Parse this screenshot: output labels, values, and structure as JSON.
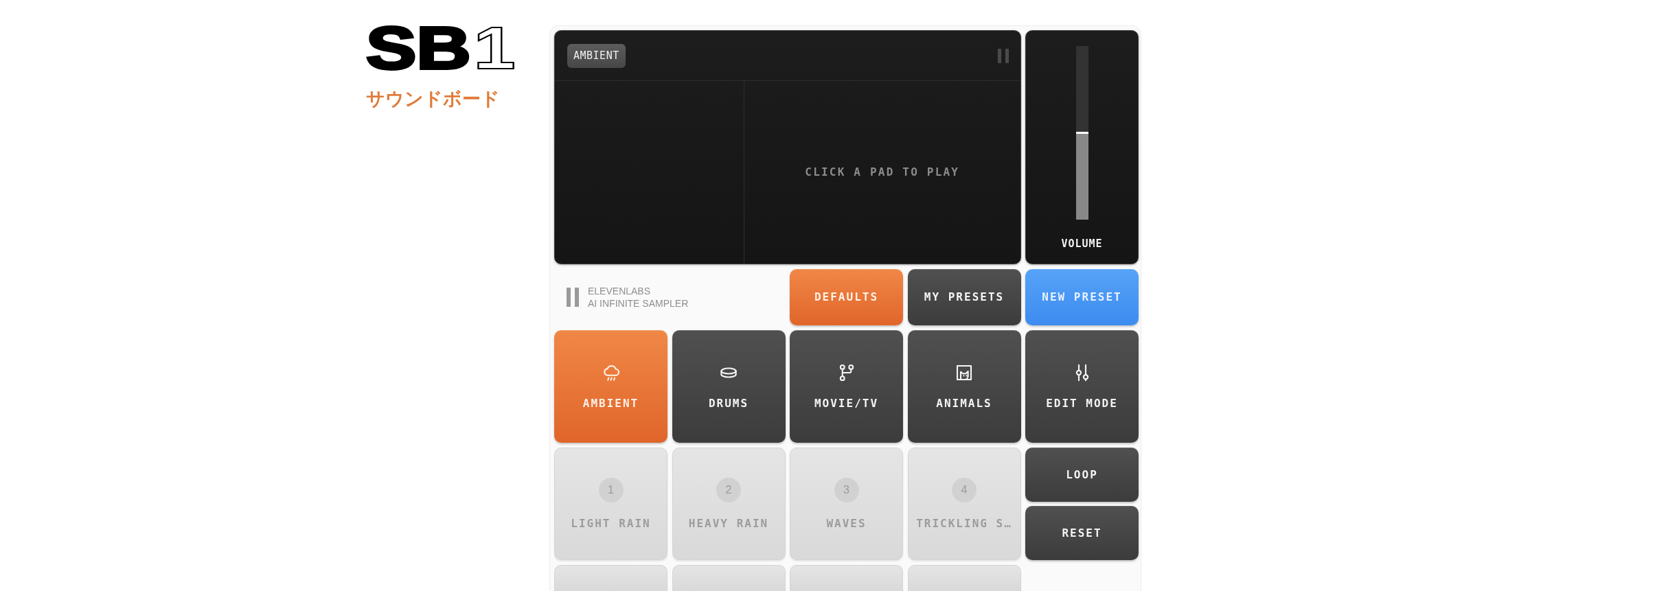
{
  "logo": {
    "text": "SB",
    "outlined_text": "1"
  },
  "subtitle": "サウンドボード",
  "display": {
    "badge": "AMBIENT",
    "message": "CLICK A PAD TO PLAY"
  },
  "volume": {
    "label": "VOLUME",
    "level": 0.5
  },
  "brand": {
    "name": "ELEVENLABS",
    "tagline": "AI INFINITE SAMPLER"
  },
  "preset_tabs": [
    {
      "label": "DEFAULTS",
      "selected": true
    },
    {
      "label": "MY PRESETS",
      "selected": false
    }
  ],
  "new_preset_button": {
    "label": "NEW PRESET"
  },
  "categories": [
    {
      "label": "AMBIENT",
      "selected": true
    },
    {
      "label": "DRUMS",
      "selected": false
    },
    {
      "label": "MOVIE/TV",
      "selected": false
    },
    {
      "label": "ANIMALS",
      "selected": false
    }
  ],
  "edit_mode_button": {
    "label": "EDIT MODE"
  },
  "pads": [
    {
      "kind": "sound",
      "number": "1",
      "label": "LIGHT RAIN"
    },
    {
      "kind": "sound",
      "number": "2",
      "label": "HEAVY RAIN"
    },
    {
      "kind": "sound",
      "number": "3",
      "label": "WAVES"
    },
    {
      "kind": "sound",
      "number": "4",
      "label": "TRICKLING S…"
    },
    {
      "kind": "blank"
    },
    {
      "kind": "blank"
    },
    {
      "kind": "blank"
    },
    {
      "kind": "blank"
    }
  ],
  "side_buttons": [
    {
      "label": "LOOP"
    },
    {
      "label": "RESET"
    }
  ]
}
